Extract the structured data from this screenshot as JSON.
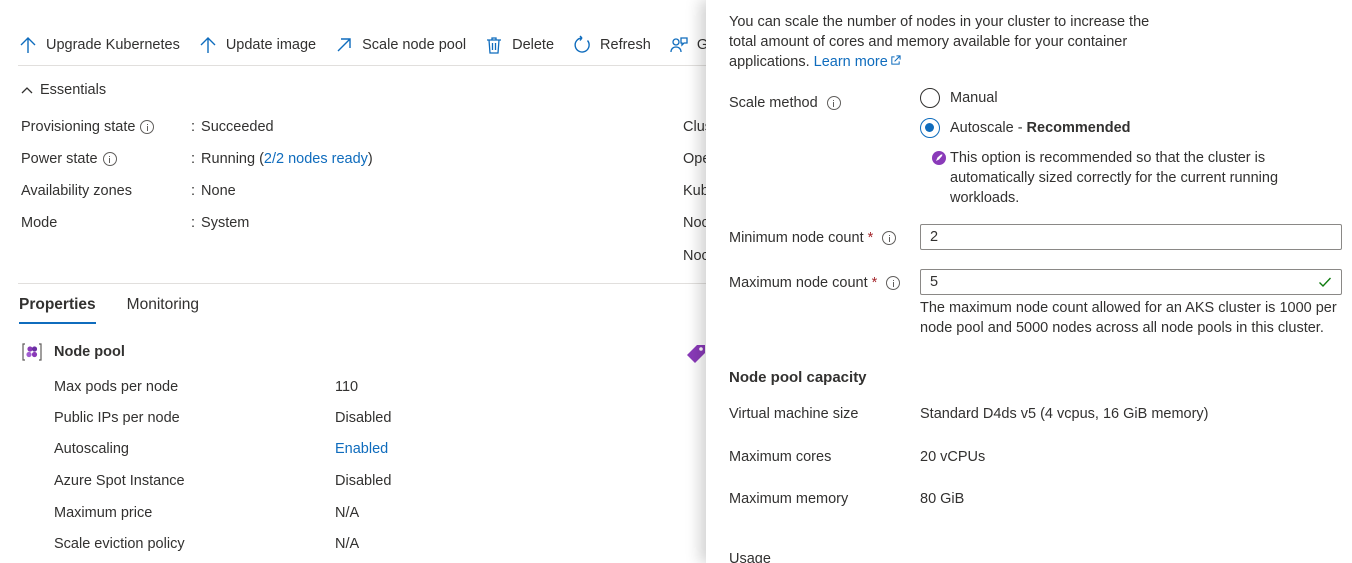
{
  "toolbar": {
    "items": [
      {
        "label": "Upgrade Kubernetes",
        "icon": "arrow-up-icon"
      },
      {
        "label": "Update image",
        "icon": "arrow-up-icon"
      },
      {
        "label": "Scale node pool",
        "icon": "arrow-diagonal-icon"
      },
      {
        "label": "Delete",
        "icon": "trash-icon"
      },
      {
        "label": "Refresh",
        "icon": "refresh-icon"
      },
      {
        "label": "G",
        "icon": "feedback-icon"
      }
    ]
  },
  "essentials": {
    "title": "Essentials",
    "rows": [
      {
        "key": "Provisioning state",
        "colon": ":",
        "value": "Succeeded"
      },
      {
        "key": "Power state",
        "colon": ":",
        "value_prefix": "Running (",
        "value_link": "2/2 nodes ready",
        "value_suffix": ")"
      },
      {
        "key": "Availability zones",
        "colon": ":",
        "value": "None"
      },
      {
        "key": "Mode",
        "colon": ":",
        "value": "System"
      }
    ],
    "right_col": [
      "Clus",
      "Ope",
      "Kub",
      "Noc",
      "Noc"
    ]
  },
  "tabs": [
    "Properties",
    "Monitoring"
  ],
  "node_pool": {
    "title": "Node pool",
    "props": [
      {
        "key": "Max pods per node",
        "value": "110"
      },
      {
        "key": "Public IPs per node",
        "value": "Disabled"
      },
      {
        "key": "Autoscaling",
        "value": "Enabled"
      },
      {
        "key": "Azure Spot Instance",
        "value": "Disabled"
      },
      {
        "key": "Maximum price",
        "value": "N/A"
      },
      {
        "key": "Scale eviction policy",
        "value": "N/A"
      }
    ]
  },
  "panel": {
    "intro": "You can scale the number of nodes in your cluster to increase the total amount of cores and memory available for your container applications.",
    "learn_more": "Learn more",
    "scale_method_label": "Scale method",
    "manual_label": "Manual",
    "autoscale_label": "Autoscale - ",
    "recommended_label": "Recommended",
    "recommend_text": "This option is recommended so that the cluster is automatically sized correctly for the current running workloads.",
    "min_label": "Minimum node count",
    "min_value": "2",
    "max_label": "Maximum node count",
    "max_value": "5",
    "required_mark": "*",
    "max_hint": "The maximum node count allowed for an AKS cluster is 1000 per node pool and 5000 nodes across all node pools in this cluster.",
    "capacity_title": "Node pool capacity",
    "capacity": [
      {
        "key": "Virtual machine size",
        "value": "Standard D4ds v5 (4 vcpus, 16 GiB memory)"
      },
      {
        "key": "Maximum cores",
        "value": "20 vCPUs"
      },
      {
        "key": "Maximum memory",
        "value": "80 GiB"
      }
    ],
    "usage_title": "Usage"
  },
  "colors": {
    "accent": "#0f6cbd",
    "required": "#a4262c",
    "valid": "#107c10",
    "recommend": "#8a3ab9"
  }
}
